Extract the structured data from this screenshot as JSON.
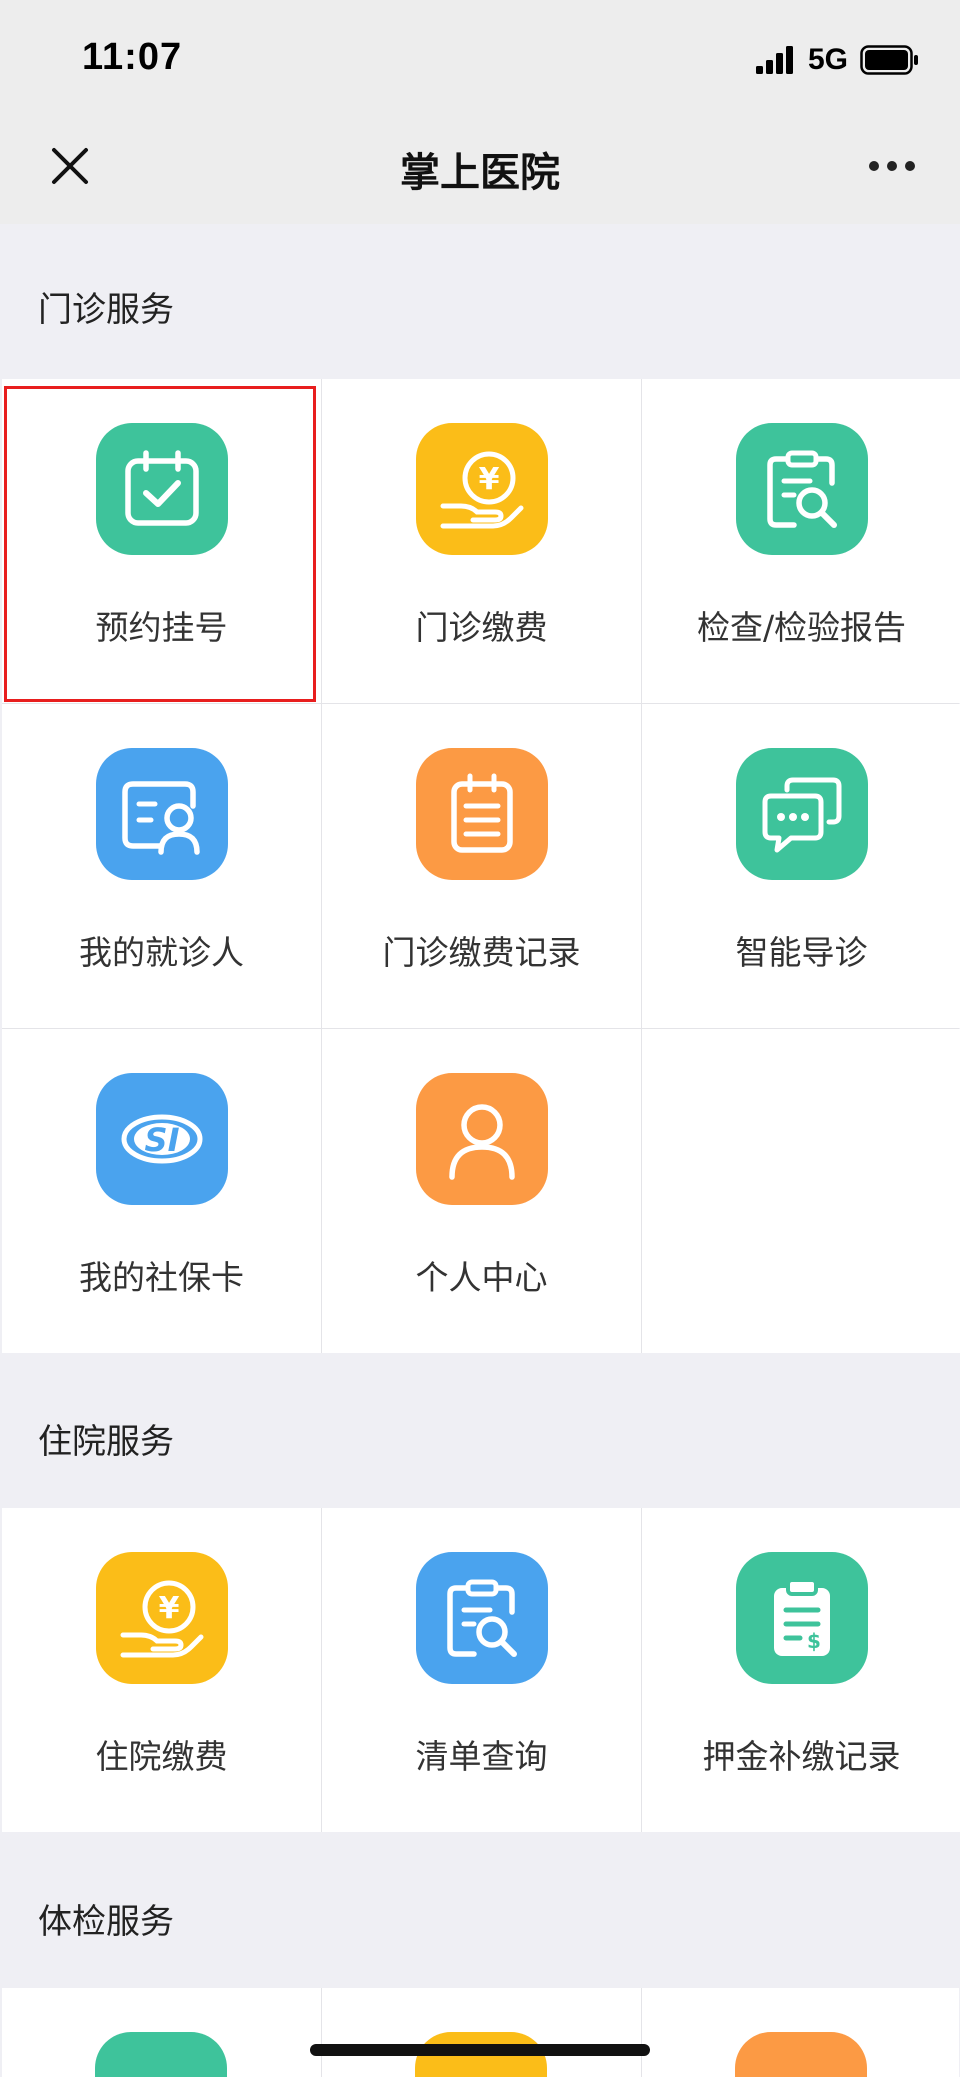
{
  "status_bar": {
    "time": "11:07",
    "network": "5G"
  },
  "nav": {
    "title": "掌上医院",
    "close_icon": "close-icon",
    "more_icon": "more-icon"
  },
  "sections": [
    {
      "title": "门诊服务",
      "items": [
        {
          "label": "预约挂号",
          "icon": "calendar-check-icon",
          "color": "#3ec39b",
          "selected": true
        },
        {
          "label": "门诊缴费",
          "icon": "yuan-hand-icon",
          "color": "#fbbd18"
        },
        {
          "label": "检查/检验报告",
          "icon": "report-search-icon",
          "color": "#3ec39b"
        },
        {
          "label": "我的就诊人",
          "icon": "patient-card-icon",
          "color": "#4aa3ee"
        },
        {
          "label": "门诊缴费记录",
          "icon": "notepad-icon",
          "color": "#fc9a44"
        },
        {
          "label": "智能导诊",
          "icon": "chat-bubbles-icon",
          "color": "#3ec39b"
        },
        {
          "label": "我的社保卡",
          "icon": "social-security-icon",
          "color": "#4aa3ee"
        },
        {
          "label": "个人中心",
          "icon": "person-icon",
          "color": "#fc9a44"
        }
      ]
    },
    {
      "title": "住院服务",
      "items": [
        {
          "label": "住院缴费",
          "icon": "yuan-hand-icon",
          "color": "#fbbd18"
        },
        {
          "label": "清单查询",
          "icon": "report-search-icon",
          "color": "#4aa3ee"
        },
        {
          "label": "押金补缴记录",
          "icon": "clipboard-dollar-icon",
          "color": "#3ec39b"
        }
      ]
    },
    {
      "title": "体检服务"
    }
  ],
  "colors": {
    "green": "#3ec39b",
    "yellow": "#fbbd18",
    "blue": "#4aa3ee",
    "orange": "#fc9a44",
    "selection": "#e81e1e"
  }
}
